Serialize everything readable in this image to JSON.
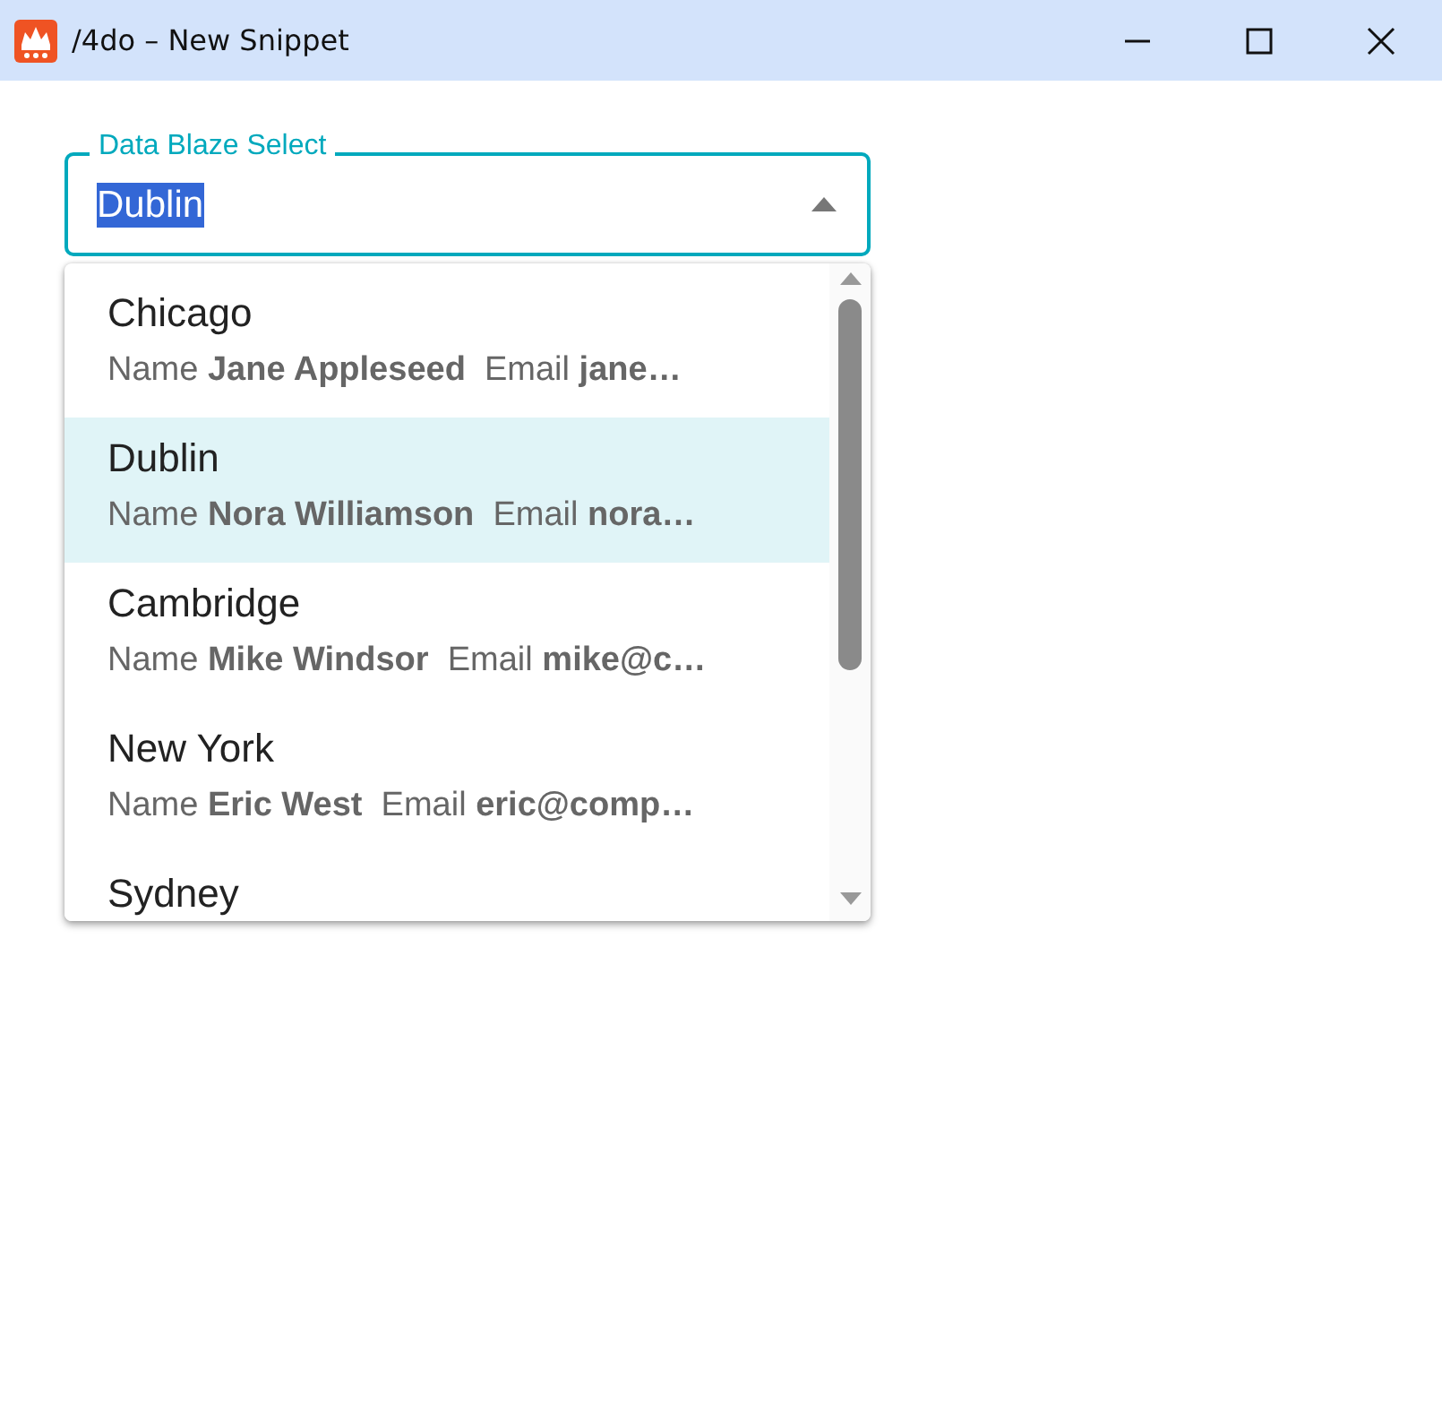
{
  "window": {
    "title": "/4do – New Snippet"
  },
  "select": {
    "label": "Data Blaze Select",
    "value": "Dublin",
    "expanded": true
  },
  "options": [
    {
      "title": "Chicago",
      "detail": "Name **Jane Appleseed**  Email **jane…**",
      "selected": false
    },
    {
      "title": "Dublin",
      "detail": "Name **Nora Williamson**  Email **nora…**",
      "selected": true
    },
    {
      "title": "Cambridge",
      "detail": "Name **Mike Windsor**  Email **mike@c…**",
      "selected": false
    },
    {
      "title": "New York",
      "detail": "Name **Eric West**  Email **eric@comp…**",
      "selected": false
    },
    {
      "title": "Sydney",
      "selected": false
    }
  ]
}
